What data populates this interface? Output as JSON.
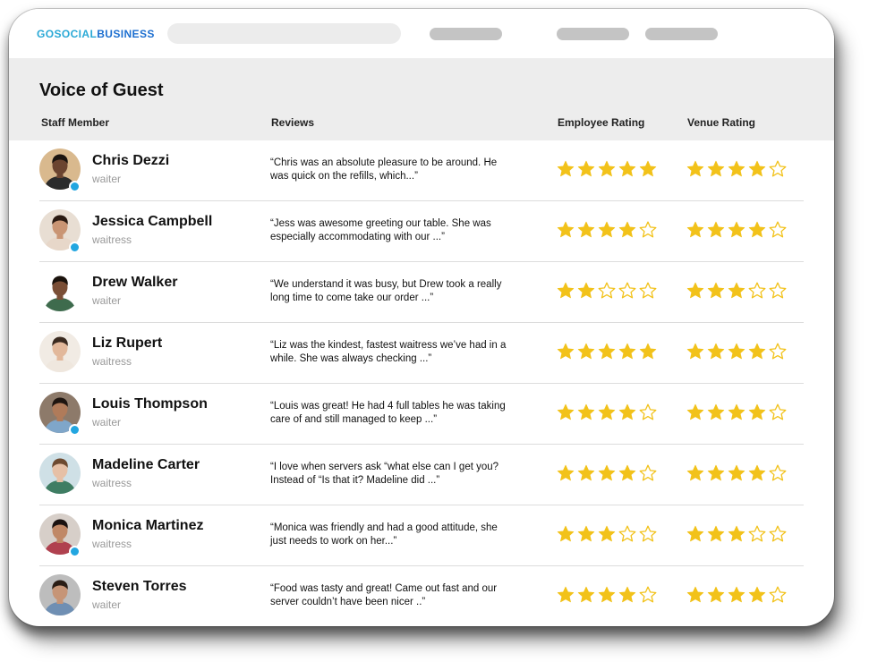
{
  "brand": {
    "prefix": "GOSOCIAL",
    "suffix": "BUSINESS"
  },
  "page": {
    "title": "Voice of Guest"
  },
  "columns": {
    "staff": "Staff Member",
    "reviews": "Reviews",
    "employee_rating": "Employee Rating",
    "venue_rating": "Venue Rating"
  },
  "colors": {
    "accent": "#2aa9d6",
    "star": "#f2c21a",
    "status_dot": "#22a6e0"
  },
  "staff": [
    {
      "name": "Chris Dezzi",
      "role": "waiter",
      "review": "“Chris was an absolute pleasure to be around. He was quick on the refills, which...”",
      "employee_rating": 5,
      "venue_rating": 4,
      "online": true,
      "skin": "#6b4430",
      "hair": "#1b1410",
      "shirt": "#2b2b2b",
      "bg": "#d9b98e"
    },
    {
      "name": "Jessica Campbell",
      "role": "waitress",
      "review": "“Jess was awesome greeting our table. She was especially accommodating with our ...”",
      "employee_rating": 4,
      "venue_rating": 4,
      "online": true,
      "skin": "#c99574",
      "hair": "#2a1a12",
      "shirt": "#e7d7c9",
      "bg": "#e8ded3"
    },
    {
      "name": "Drew Walker",
      "role": "waiter",
      "review": "“We understand it was busy, but Drew took a really long time to come take our order ...”",
      "employee_rating": 2,
      "venue_rating": 3,
      "online": false,
      "skin": "#7a4e36",
      "hair": "#1a120c",
      "shirt": "#3e6b4d",
      "bg": "#ffffff"
    },
    {
      "name": "Liz Rupert",
      "role": "waitress",
      "review": "“Liz was the kindest, fastest waitress we’ve had in a while. She was always checking  ...”",
      "employee_rating": 5,
      "venue_rating": 4,
      "online": false,
      "skin": "#e2b89b",
      "hair": "#3a2a20",
      "shirt": "#efe7de",
      "bg": "#f1ebe4"
    },
    {
      "name": "Louis Thompson",
      "role": "waiter",
      "review": "“Louis was great! He had 4 full tables he was taking care of and still managed to keep  ...”",
      "employee_rating": 4,
      "venue_rating": 4,
      "online": true,
      "skin": "#b07b5a",
      "hair": "#1e1510",
      "shirt": "#7fa6c9",
      "bg": "#8d7a6a"
    },
    {
      "name": "Madeline Carter",
      "role": "waitress",
      "review": "“I love when servers ask “what else can I get you? Instead of “Is that it? Madeline did  ...”",
      "employee_rating": 4,
      "venue_rating": 4,
      "online": false,
      "skin": "#e6c0a6",
      "hair": "#6d4a30",
      "shirt": "#3f7d63",
      "bg": "#cfe0e6"
    },
    {
      "name": "Monica Martinez",
      "role": "waitress",
      "review": "“Monica was friendly and had a good attitude, she just  needs to work on her...”",
      "employee_rating": 3,
      "venue_rating": 3,
      "online": true,
      "skin": "#c08866",
      "hair": "#1a1210",
      "shirt": "#b0414f",
      "bg": "#d7cfc9"
    },
    {
      "name": "Steven Torres",
      "role": "waiter",
      "review": "“Food was tasty and great! Came out fast and our server couldn’t have been nicer ..”",
      "employee_rating": 4,
      "venue_rating": 4,
      "online": false,
      "skin": "#c69577",
      "hair": "#2a1d15",
      "shirt": "#6f8fb3",
      "bg": "#bdbdbd"
    }
  ]
}
